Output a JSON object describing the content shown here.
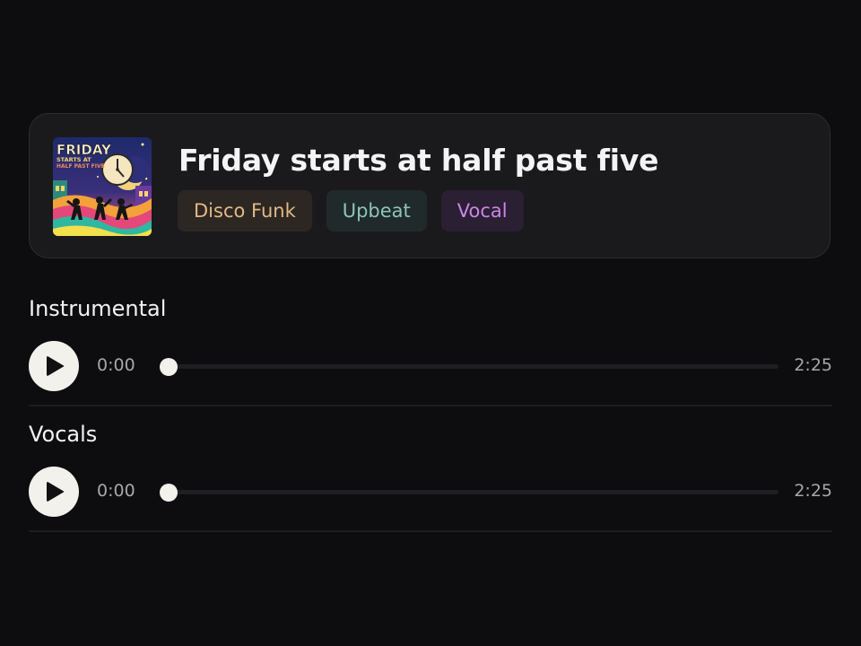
{
  "song": {
    "title": "Friday starts at half past five",
    "cover": {
      "text_line1": "FRIDAY",
      "text_line2": "STARTS AT",
      "text_line3": "HALF PAST FIVE"
    },
    "tags": [
      {
        "label": "Disco Funk",
        "color": "#e2b887"
      },
      {
        "label": "Upbeat",
        "color": "#8fc3b9"
      },
      {
        "label": "Vocal",
        "color": "#cb86e9"
      }
    ]
  },
  "tracks": [
    {
      "label": "Instrumental",
      "current_time": "0:00",
      "duration": "2:25",
      "progress": 0,
      "play_icon": "play-icon"
    },
    {
      "label": "Vocals",
      "current_time": "0:00",
      "duration": "2:25",
      "progress": 0,
      "play_icon": "play-icon"
    }
  ],
  "colors": {
    "background": "#0d0d0f",
    "card": "#1a1a1d",
    "accent_light": "#f3f1ec"
  }
}
